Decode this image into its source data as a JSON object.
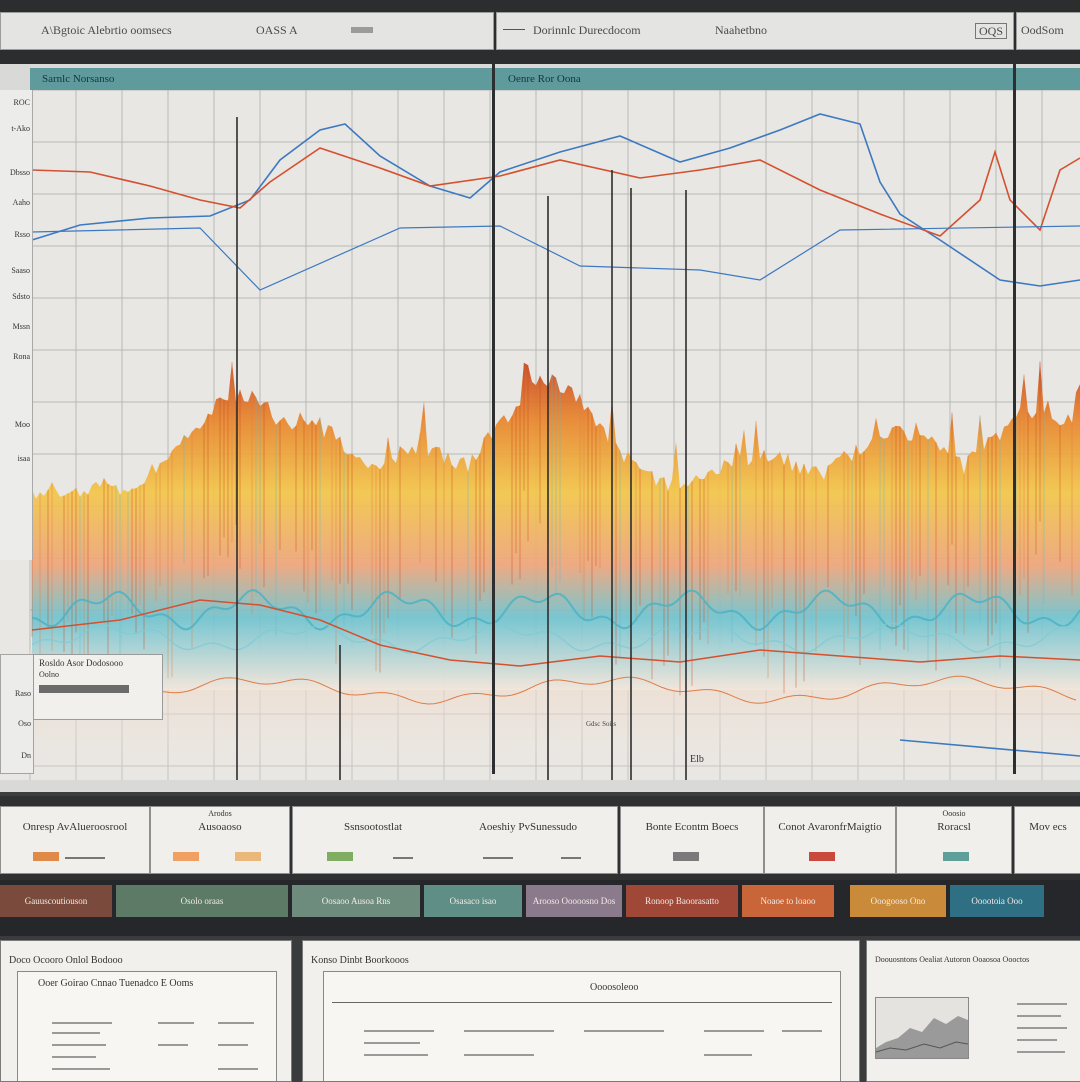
{
  "top_bar": {
    "left_title": "A\\Bgtoic Alebrtio oomsecs",
    "left_code": "OASS A",
    "center_title": "Dorinnlc Durecdocom",
    "center_right": "Naahetbno",
    "right_code": "OQS",
    "far_right": "OodSom"
  },
  "main_panel": {
    "left_header": "Sarnlc Norsanso",
    "center_header": "Oenre Ror Oona",
    "y_ticks": [
      "ROC",
      "t-Ako",
      "Dbsso",
      "Aaho",
      "Rsso",
      "Saaso",
      "Sdsto",
      "Mssn",
      "Rona",
      "Moo",
      "isaa"
    ],
    "overlay_title": "Rosldo Asor Dodosooo",
    "overlay_sub": "Oolno",
    "side_ticks": [
      "",
      "Raso",
      "Oso",
      "Dn"
    ],
    "mid_label": "Gdsc Soiis",
    "foot_label": "Elb"
  },
  "metric_cards": [
    {
      "title": "Onresp AvAlueroosrool",
      "bar_color": "#e08a4a"
    },
    {
      "title": "Ausoaoso",
      "heading": "Arodos",
      "bar_color": "#f0a060"
    },
    {
      "title": "Ssnsootostlat",
      "bar_color": "#7fae62"
    },
    {
      "title": "Aoeshiy PvSunessudo",
      "bar_color": "#d9d9d9"
    },
    {
      "title": "Bonte Econtm Boecs",
      "bar_color": "#7a7a7a"
    },
    {
      "title": "Conot AvaronfrMaigtio",
      "bar_color": "#c94a3a"
    },
    {
      "title": "Roracsl",
      "heading": "Ooosio",
      "bar_color": "#5e9f9a"
    },
    {
      "title": "Mov ecs",
      "bar_color": "#cccccc"
    }
  ],
  "color_tabs": [
    {
      "label": "Gauuscoutiouson",
      "color": "#7a4a3c"
    },
    {
      "label": "Osolo oraas",
      "color": "#5c7a66"
    },
    {
      "label": "Oosaoo Ausoa Rns",
      "color": "#6e8c7e"
    },
    {
      "label": "Osasaco isao",
      "color": "#5f8e86"
    },
    {
      "label": "Arooso Ooooosno Dos",
      "color": "#8a7a8c"
    },
    {
      "label": "Ronoop Baoorasatto",
      "color": "#a04838"
    },
    {
      "label": "Noaoe to loaoo",
      "color": "#c8663a"
    },
    {
      "label": "Ooogooso Ono",
      "color": "#c98a3a"
    },
    {
      "label": "Ooootoia Ooo",
      "color": "#2e6f83"
    }
  ],
  "documents": [
    {
      "title": "Doco Ocooro Onlol Bodooo",
      "subtitle": "Ooer Goirao Cnnao   Tuenadco E Ooms"
    },
    {
      "title": "Konso Dinbt Boorkooos",
      "subtitle": "Oooosoleoo"
    },
    {
      "title": "Doouosntons Oealiat Autoron Ooaosoa Oooctos",
      "subtitle": ""
    }
  ],
  "colors": {
    "orange_ridge": "#e8862c",
    "yellow_fill": "#f3c648",
    "blue_line": "#3c79c0",
    "red_line": "#d4502e",
    "teal_band": "#4bb3c4"
  }
}
